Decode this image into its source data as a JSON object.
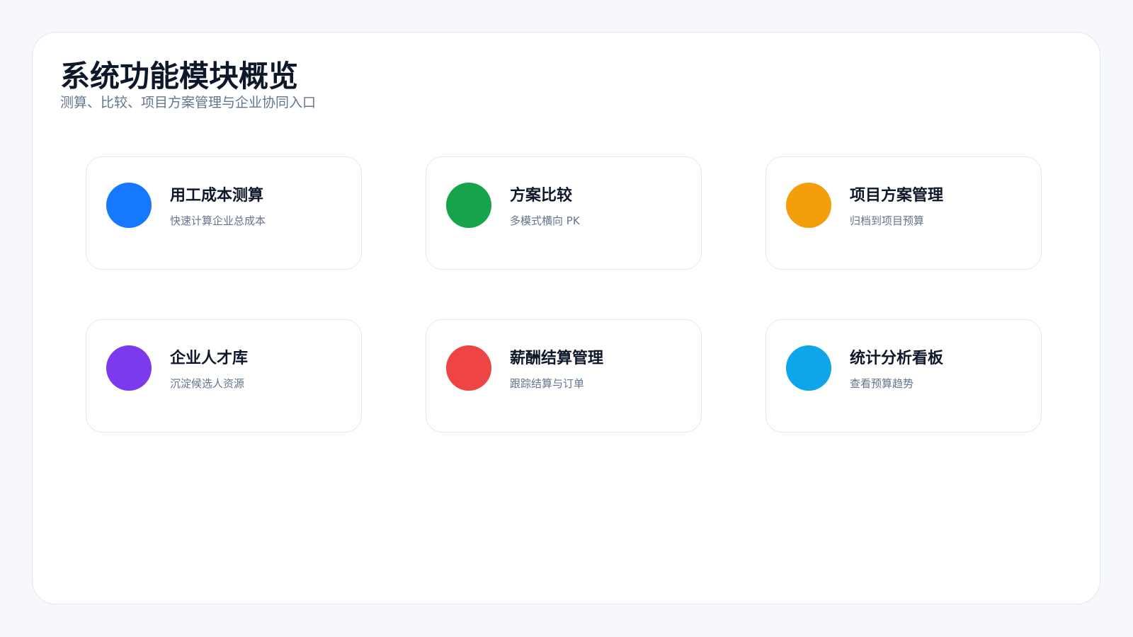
{
  "header": {
    "title": "系统功能模块概览",
    "subtitle": "测算、比较、项目方案管理与企业协同入口"
  },
  "modules": [
    {
      "title": "用工成本测算",
      "desc": "快速计算企业总成本",
      "color": "#1677ff"
    },
    {
      "title": "方案比较",
      "desc": "多模式横向 PK",
      "color": "#16a34a"
    },
    {
      "title": "项目方案管理",
      "desc": "归档到项目预算",
      "color": "#f59e0b"
    },
    {
      "title": "企业人才库",
      "desc": "沉淀候选人资源",
      "color": "#7c3aed"
    },
    {
      "title": "薪酬结算管理",
      "desc": "跟踪结算与订单",
      "color": "#ef4444"
    },
    {
      "title": "统计分析看板",
      "desc": "查看预算趋势",
      "color": "#0ea5e9"
    }
  ]
}
